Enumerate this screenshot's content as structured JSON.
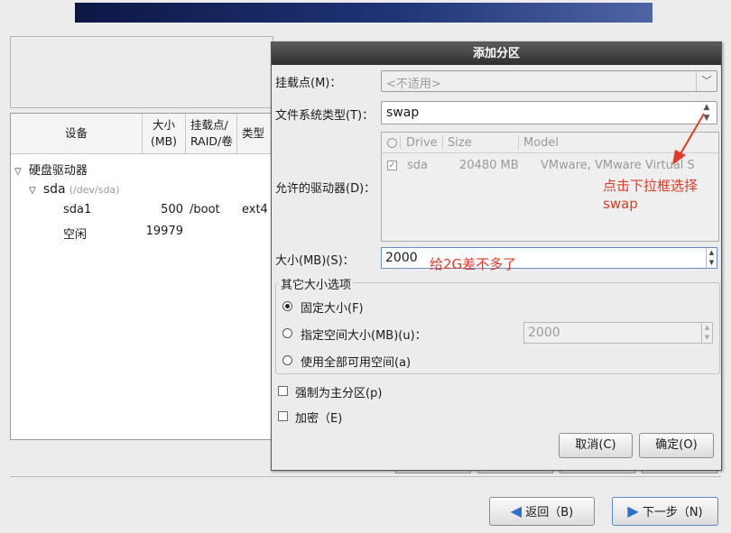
{
  "tree": {
    "headers": {
      "device": "设备",
      "size_1": "大小",
      "size_2": "(MB)",
      "mount_1": "挂载点/",
      "mount_2": "RAID/卷",
      "type": "类型"
    },
    "group_label": "硬盘驱动器",
    "disk_name": "sda",
    "disk_path": "(/dev/sda)",
    "rows": [
      {
        "name": "sda1",
        "size": "500",
        "mount": "/boot",
        "type": "ext4"
      },
      {
        "name": "空闲",
        "size": "19979",
        "mount": "",
        "type": ""
      }
    ]
  },
  "dialog": {
    "title": "添加分区",
    "mount_label": "挂载点(M)：",
    "mount_value": "<不适用>",
    "fstype_label": "文件系统类型(T)：",
    "fstype_value": "swap",
    "drives_label": "允许的驱动器(D)：",
    "drive_columns": {
      "drive": "Drive",
      "size": "Size",
      "model": "Model"
    },
    "drives": [
      {
        "name": "sda",
        "size": "20480 MB",
        "model": "VMware, VMware Virtual S",
        "checked": true
      }
    ],
    "size_label": "大小(MB)(S)：",
    "size_value": "2000",
    "other_group_label": "其它大小选项",
    "opt_fixed": "固定大小(F)",
    "opt_upto": "指定空间大小(MB)(u)：",
    "opt_upto_value": "2000",
    "opt_fill": "使用全部可用空间(a)",
    "force_primary": "强制为主分区(p)",
    "encrypt": "加密（E)",
    "cancel": "取消(C)",
    "ok": "确定(O)"
  },
  "nav": {
    "back": "返回（B)",
    "next": "下一步（N)"
  },
  "annotations": {
    "dropdown_note_1": "点击下拉框选择",
    "dropdown_note_2": "swap",
    "size_note": "给2G差不多了"
  },
  "colors": {
    "annotation": "#e03a2a",
    "title_bar": "#3a3a3a",
    "nav_arrow": "#2c6fc9"
  }
}
